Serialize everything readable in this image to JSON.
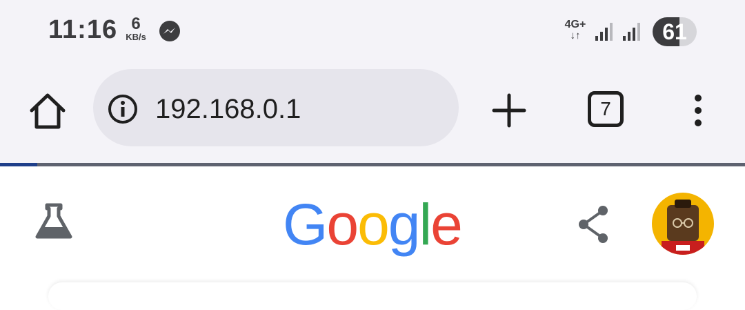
{
  "status_bar": {
    "time": "11:16",
    "net_speed_value": "6",
    "net_speed_unit": "KB/s",
    "network_type": "4G+",
    "network_arrows": "↓↑",
    "battery_level": "61",
    "battery_fraction": 0.61,
    "icons": [
      "messenger-icon",
      "signal-icon",
      "signal-icon"
    ]
  },
  "toolbar": {
    "url": "192.168.0.1",
    "tab_count": "7",
    "icons": [
      "home-icon",
      "info-icon",
      "plus-icon",
      "tab-switcher-icon",
      "more-vert-icon"
    ]
  },
  "page_load_progress": 0.05,
  "page": {
    "logo_letters": [
      {
        "char": "G",
        "color": "#4285F4"
      },
      {
        "char": "o",
        "color": "#EA4335"
      },
      {
        "char": "o",
        "color": "#FBBC05"
      },
      {
        "char": "g",
        "color": "#4285F4"
      },
      {
        "char": "l",
        "color": "#34A853"
      },
      {
        "char": "e",
        "color": "#EA4335"
      }
    ],
    "icons": [
      "labs-flask-icon",
      "share-icon",
      "avatar"
    ]
  },
  "colors": {
    "chrome_bg": "#f4f3f8",
    "omnibox_bg": "#e6e5ec",
    "progress_fill": "#1f3f8a",
    "avatar_bg": "#f4b400"
  }
}
